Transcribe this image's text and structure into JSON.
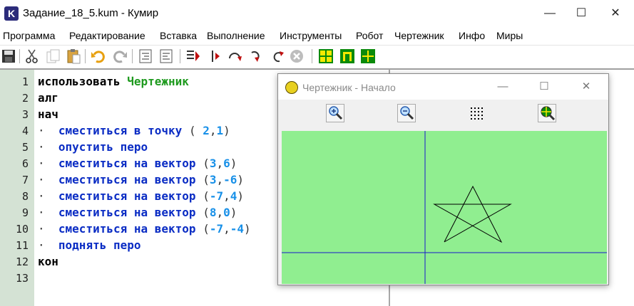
{
  "window": {
    "title": "Задание_18_5.kum - Кумир",
    "logo": "K",
    "min_glyph": "—",
    "max_glyph": "☐",
    "close_glyph": "✕"
  },
  "menu": [
    "Программа",
    "Редактирование",
    "Вставка",
    "Выполнение",
    "Инструменты",
    "Робот",
    "Чертежник",
    "Инфо",
    "Миры"
  ],
  "editor": {
    "line_numbers": [
      "1",
      "2",
      "3",
      "4",
      "5",
      "6",
      "7",
      "8",
      "9",
      "10",
      "11",
      "12",
      "13"
    ],
    "lines": {
      "l1_kw": "использовать",
      "l1_mod": "Чертежник",
      "l2": "алг",
      "l3": "нач",
      "l4_cmd": "сместиться в точку",
      "l4_open": "(",
      "l4_a": "2",
      "l4_comma": ",",
      "l4_b": "1",
      "l4_close": ")",
      "l5_cmd": "опустить перо",
      "vec_cmd": "сместиться на вектор",
      "l6_a": "3",
      "l6_b": "6",
      "l7_a": "3",
      "l7_b": "-6",
      "l8_a": "-7",
      "l8_b": "4",
      "l9_a": "8",
      "l9_b": "0",
      "l10_a": "-7",
      "l10_b": "-4",
      "open": "(",
      "comma": ",",
      "close": ")",
      "l11_cmd": "поднять перо",
      "l12": "кон",
      "indent_mark": "·"
    }
  },
  "drawer": {
    "title": "Чертежник - Начало",
    "tools": [
      "zoom-in-icon",
      "zoom-out-icon",
      "grid-dots-icon",
      "fit-view-icon"
    ],
    "canvas_bg": "#90ee90",
    "axis_color": "#1a1acc",
    "pen_color": "#000000"
  }
}
